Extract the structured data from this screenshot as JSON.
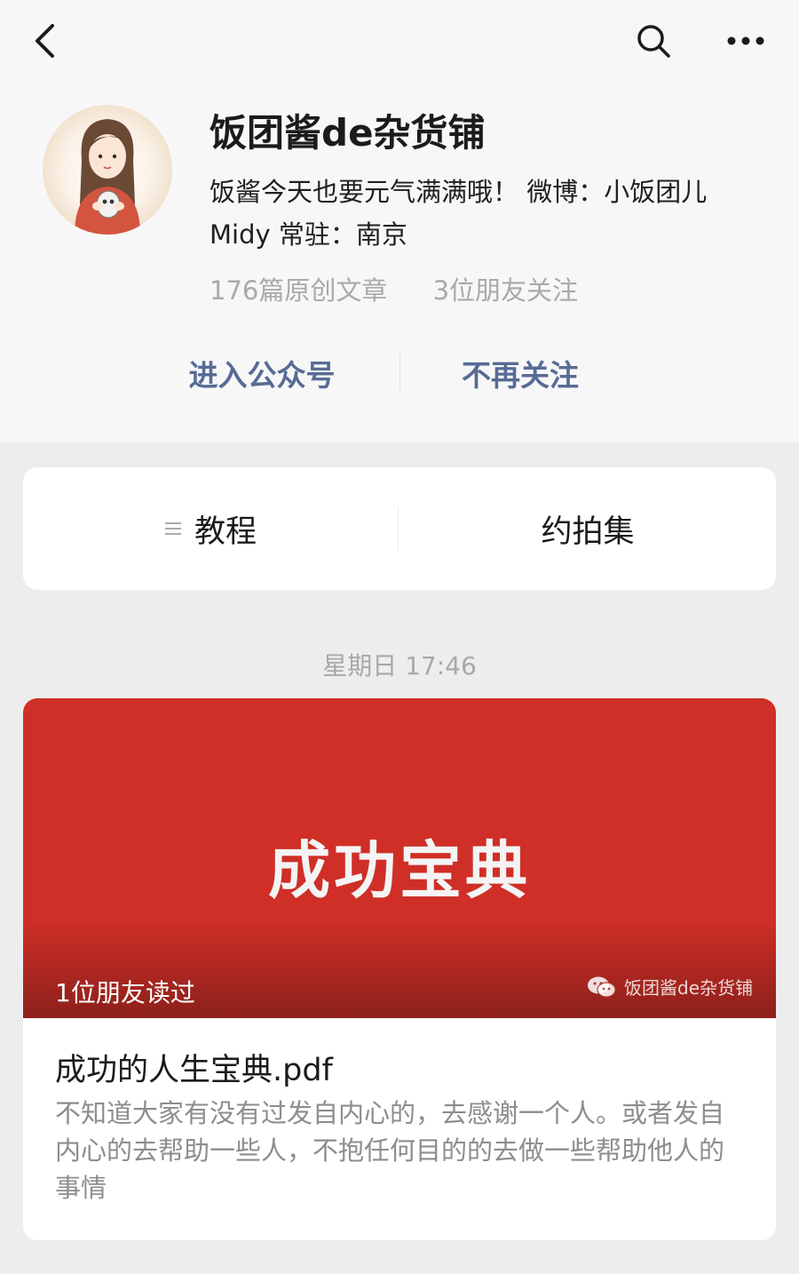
{
  "nav": {
    "back_icon": "chevron-left-icon",
    "search_icon": "search-icon",
    "more_icon": "more-dots-icon"
  },
  "profile": {
    "name": "饭团酱de杂货铺",
    "bio": "饭酱今天也要元气满满哦！ 微博：小饭团儿Midy 常驻：南京",
    "articles_count": "176篇原创文章",
    "friends_following": "3位朋友关注"
  },
  "actions": {
    "enter": "进入公众号",
    "unfollow": "不再关注"
  },
  "menu": {
    "items": [
      {
        "label": "教程",
        "icon": "menu-lines-icon"
      },
      {
        "label": "约拍集"
      }
    ]
  },
  "feed": {
    "timestamp": "星期日 17:46",
    "article": {
      "cover_title": "成功宝典",
      "friends_read": "1位朋友读过",
      "watermark": "饭团酱de杂货铺",
      "watermark_icon": "wechat-icon",
      "title": "成功的人生宝典.pdf",
      "description": "不知道大家有没有过发自内心的，去感谢一个人。或者发自内心的去帮助一些人，不抱任何目的的去做一些帮助他人的事情"
    }
  },
  "colors": {
    "link": "#576b95",
    "cover": "#cf2f27",
    "page_background": "#ededed"
  }
}
